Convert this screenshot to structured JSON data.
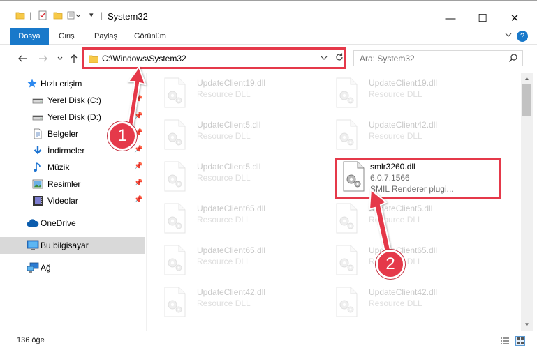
{
  "window": {
    "title": "System32",
    "controls": {
      "minimize": "—",
      "maximize": "☐",
      "close": "✕"
    }
  },
  "ribbon": {
    "tabs": [
      "Dosya",
      "Giriş",
      "Paylaş",
      "Görünüm"
    ],
    "expand_icon": "chevron-down",
    "help_icon": "?"
  },
  "address": {
    "path": "C:\\Windows\\System32",
    "search_placeholder": "Ara: System32"
  },
  "sidebar": {
    "items": [
      {
        "label": "Hızlı erişim",
        "icon": "star-icon",
        "pinned": false
      },
      {
        "label": "Yerel Disk (C:)",
        "icon": "drive-icon",
        "pinned": true
      },
      {
        "label": "Yerel Disk (D:)",
        "icon": "drive-icon",
        "pinned": true
      },
      {
        "label": "Belgeler",
        "icon": "document-icon",
        "pinned": true
      },
      {
        "label": "İndirmeler",
        "icon": "download-icon",
        "pinned": true
      },
      {
        "label": "Müzik",
        "icon": "music-icon",
        "pinned": true
      },
      {
        "label": "Resimler",
        "icon": "pictures-icon",
        "pinned": true
      },
      {
        "label": "Videolar",
        "icon": "video-icon",
        "pinned": true
      },
      {
        "label": "OneDrive",
        "icon": "cloud-icon",
        "pinned": false
      },
      {
        "label": "Bu bilgisayar",
        "icon": "computer-icon",
        "pinned": false,
        "selected": true
      },
      {
        "label": "Ağ",
        "icon": "network-icon",
        "pinned": false
      }
    ]
  },
  "files": {
    "left": [
      {
        "name": "UpdateClient19.dll",
        "type": "Resource DLL"
      },
      {
        "name": "UpdateClient5.dll",
        "type": "Resource DLL"
      },
      {
        "name": "UpdateClient5.dll",
        "type": "Resource DLL"
      },
      {
        "name": "UpdateClient65.dll",
        "type": "Resource DLL"
      },
      {
        "name": "UpdateClient65.dll",
        "type": "Resource DLL"
      },
      {
        "name": "UpdateClient42.dll",
        "type": "Resource DLL"
      }
    ],
    "right": [
      {
        "name": "UpdateClient19.dll",
        "type": "Resource DLL"
      },
      {
        "name": "UpdateClient42.dll",
        "type": "Resource DLL"
      },
      {
        "name": "smlr3260.dll",
        "version": "6.0.7.1566",
        "description": "SMIL Renderer plugi...",
        "highlighted": true
      },
      {
        "name": "UpdateClient5.dll",
        "type": "Resource DLL"
      },
      {
        "name": "UpdateClient65.dll",
        "type": "Resource DLL"
      },
      {
        "name": "UpdateClient42.dll",
        "type": "Resource DLL"
      }
    ]
  },
  "status": {
    "item_count": "136 öğe"
  },
  "annotations": {
    "step1": "1",
    "step2": "2"
  },
  "colors": {
    "accent": "#1979ca",
    "annotation": "#e5394a",
    "selected": "#d9d9d9"
  }
}
